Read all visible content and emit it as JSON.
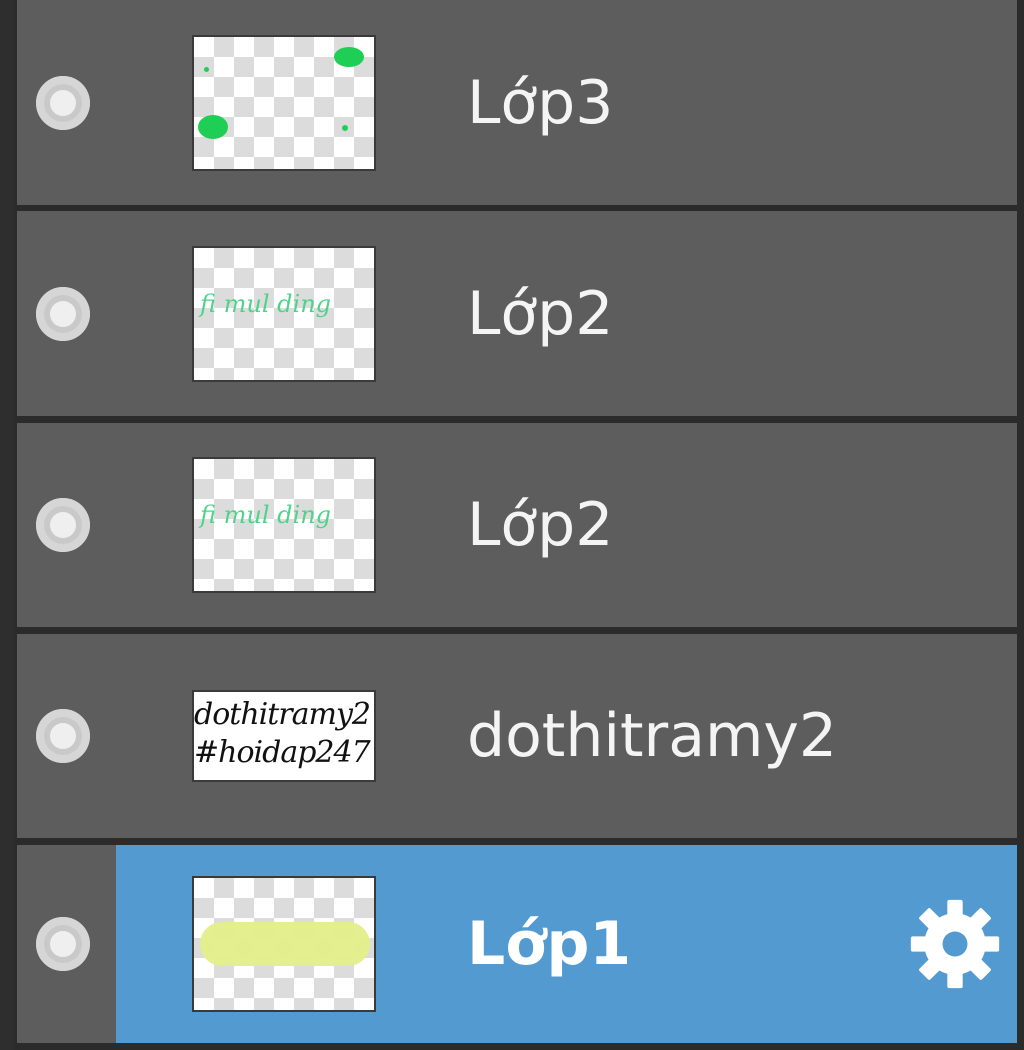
{
  "layers": [
    {
      "name": "Lớp3",
      "visible_icon": "visibility-dot-icon",
      "thumbnail": "green-specks"
    },
    {
      "name": "Lớp2",
      "visible_icon": "visibility-dot-icon",
      "thumbnail": "green-text"
    },
    {
      "name": "Lớp2",
      "visible_icon": "visibility-dot-icon",
      "thumbnail": "green-text"
    },
    {
      "name": "dothitramy2",
      "visible_icon": "visibility-dot-icon",
      "thumbnail": "text-preview",
      "thumb_text_line1": "dothitramy2",
      "thumb_text_line2": "#hoidap247"
    },
    {
      "name": "Lớp1",
      "visible_icon": "visibility-dot-icon",
      "thumbnail": "yellow-smear",
      "selected": true,
      "settings_icon": "gear-icon"
    }
  ],
  "colors": {
    "row_bg": "#5d5d5d",
    "selected_bg": "#539ad1",
    "separator": "#2b2b2b",
    "text": "#f4f4f4"
  }
}
